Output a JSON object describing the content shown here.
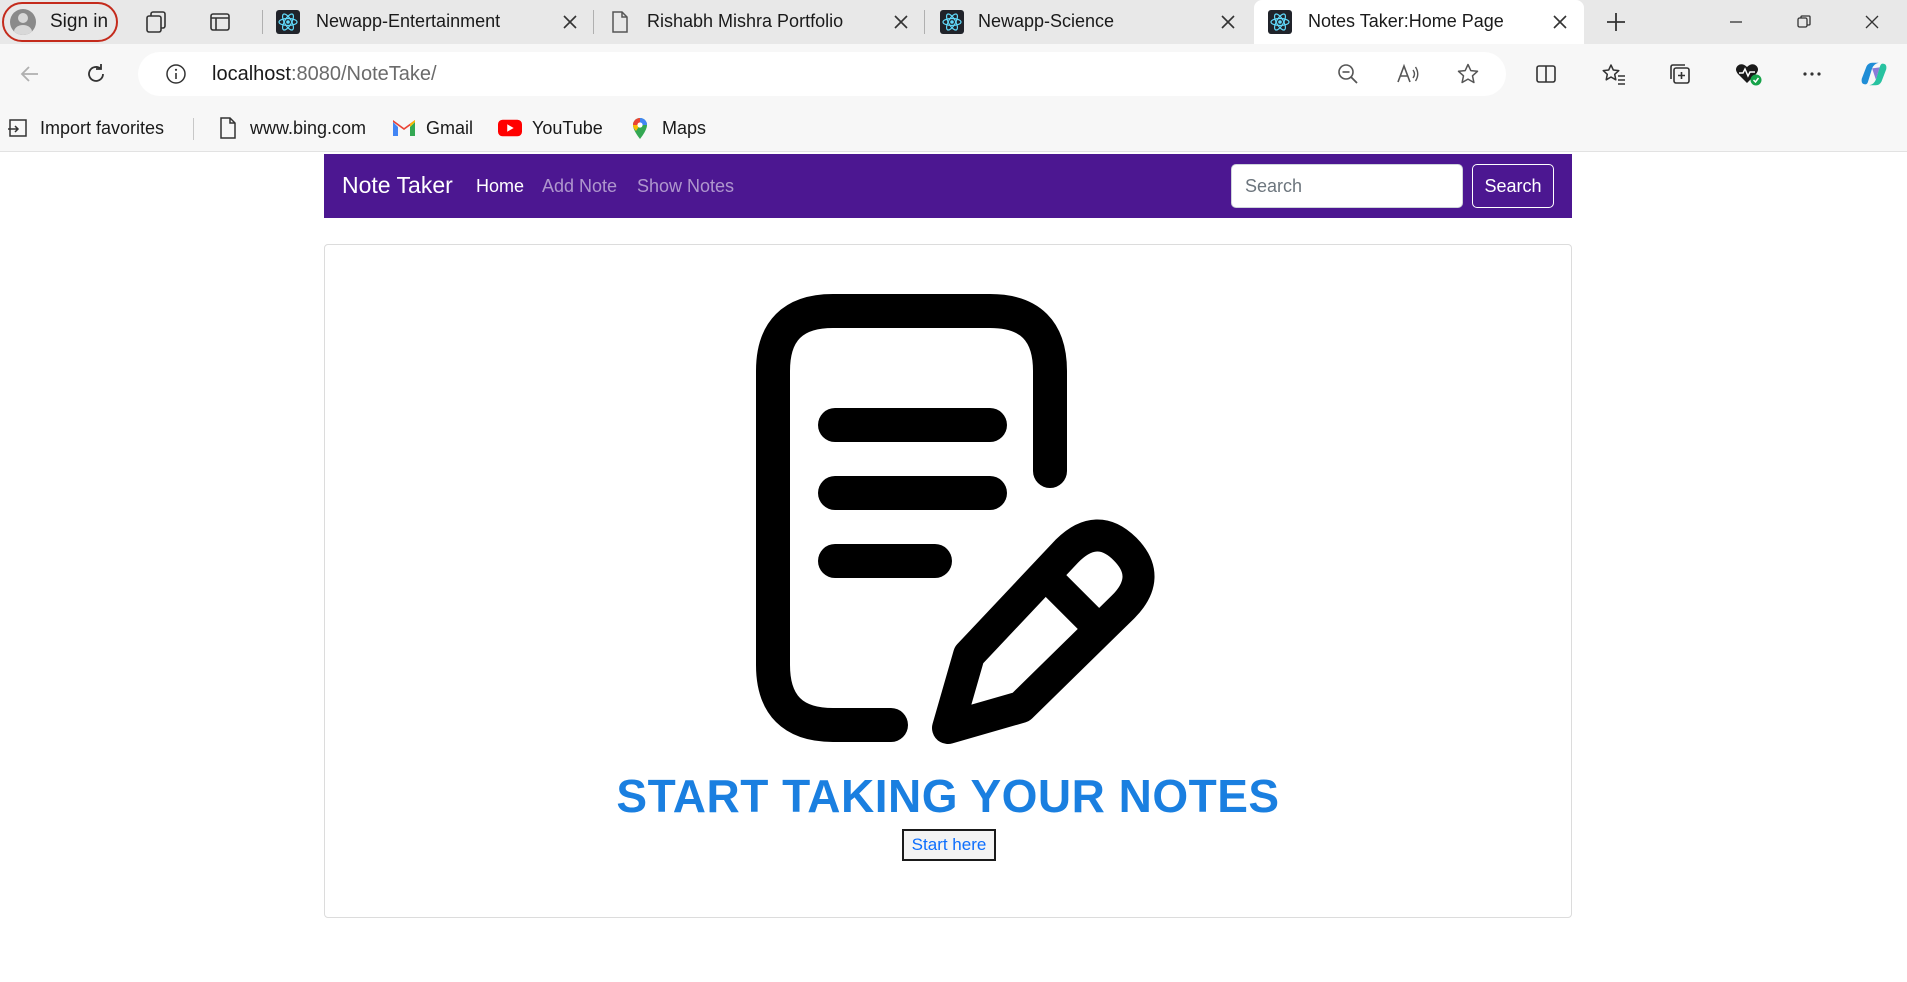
{
  "browser": {
    "signin_label": "Sign in",
    "tabs": [
      {
        "title": "Newapp-Entertainment",
        "icon": "react-icon"
      },
      {
        "title": "Rishabh Mishra Portfolio",
        "icon": "page-icon"
      },
      {
        "title": "Newapp-Science",
        "icon": "react-icon"
      },
      {
        "title": "Notes Taker:Home Page",
        "icon": "react-icon",
        "active": true
      }
    ],
    "url_host": "localhost",
    "url_rest": ":8080/NoteTake/",
    "favorites": [
      {
        "label": "Import favorites",
        "icon": "import-icon"
      },
      {
        "label": "www.bing.com",
        "icon": "page-icon"
      },
      {
        "label": "Gmail",
        "icon": "gmail-icon"
      },
      {
        "label": "YouTube",
        "icon": "youtube-icon"
      },
      {
        "label": "Maps",
        "icon": "maps-icon"
      }
    ]
  },
  "navbar": {
    "brand": "Note Taker",
    "links": [
      "Home",
      "Add Note",
      "Show Notes"
    ],
    "search_placeholder": "Search",
    "search_button": "Search",
    "color": "#4c1791"
  },
  "main": {
    "title": "START TAKING YOUR NOTES",
    "start_button": "Start here",
    "title_color": "#1a7fe0",
    "icon": "note-edit-icon"
  }
}
